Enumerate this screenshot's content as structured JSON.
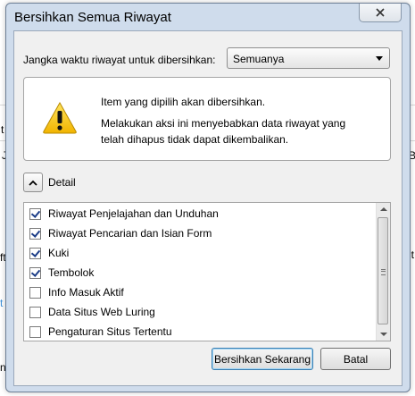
{
  "background": {
    "left_fragments": [
      "J",
      "t",
      "ft",
      "n:"
    ],
    "right_fragments": [
      "B",
      "it"
    ]
  },
  "dialog": {
    "title": "Bersihkan Semua Riwayat",
    "time_range": {
      "label": "Jangka waktu riwayat untuk dibersihkan:",
      "selected": "Semuanya"
    },
    "warning": {
      "icon": "warning-triangle-icon",
      "line1": "Item yang dipilih akan dibersihkan.",
      "line2": "Melakukan aksi ini menyebabkan data riwayat yang telah dihapus tidak dapat dikembalikan."
    },
    "details": {
      "label": "Detail",
      "expanded": true,
      "items": [
        {
          "label": "Riwayat Penjelajahan dan Unduhan",
          "checked": true
        },
        {
          "label": "Riwayat Pencarian dan Isian Form",
          "checked": true
        },
        {
          "label": "Kuki",
          "checked": true
        },
        {
          "label": "Tembolok",
          "checked": true
        },
        {
          "label": "Info Masuk Aktif",
          "checked": false
        },
        {
          "label": "Data Situs Web Luring",
          "checked": false
        },
        {
          "label": "Pengaturan Situs Tertentu",
          "checked": false
        }
      ]
    },
    "buttons": {
      "clear_now": "Bersihkan Sekarang",
      "cancel": "Batal"
    }
  }
}
